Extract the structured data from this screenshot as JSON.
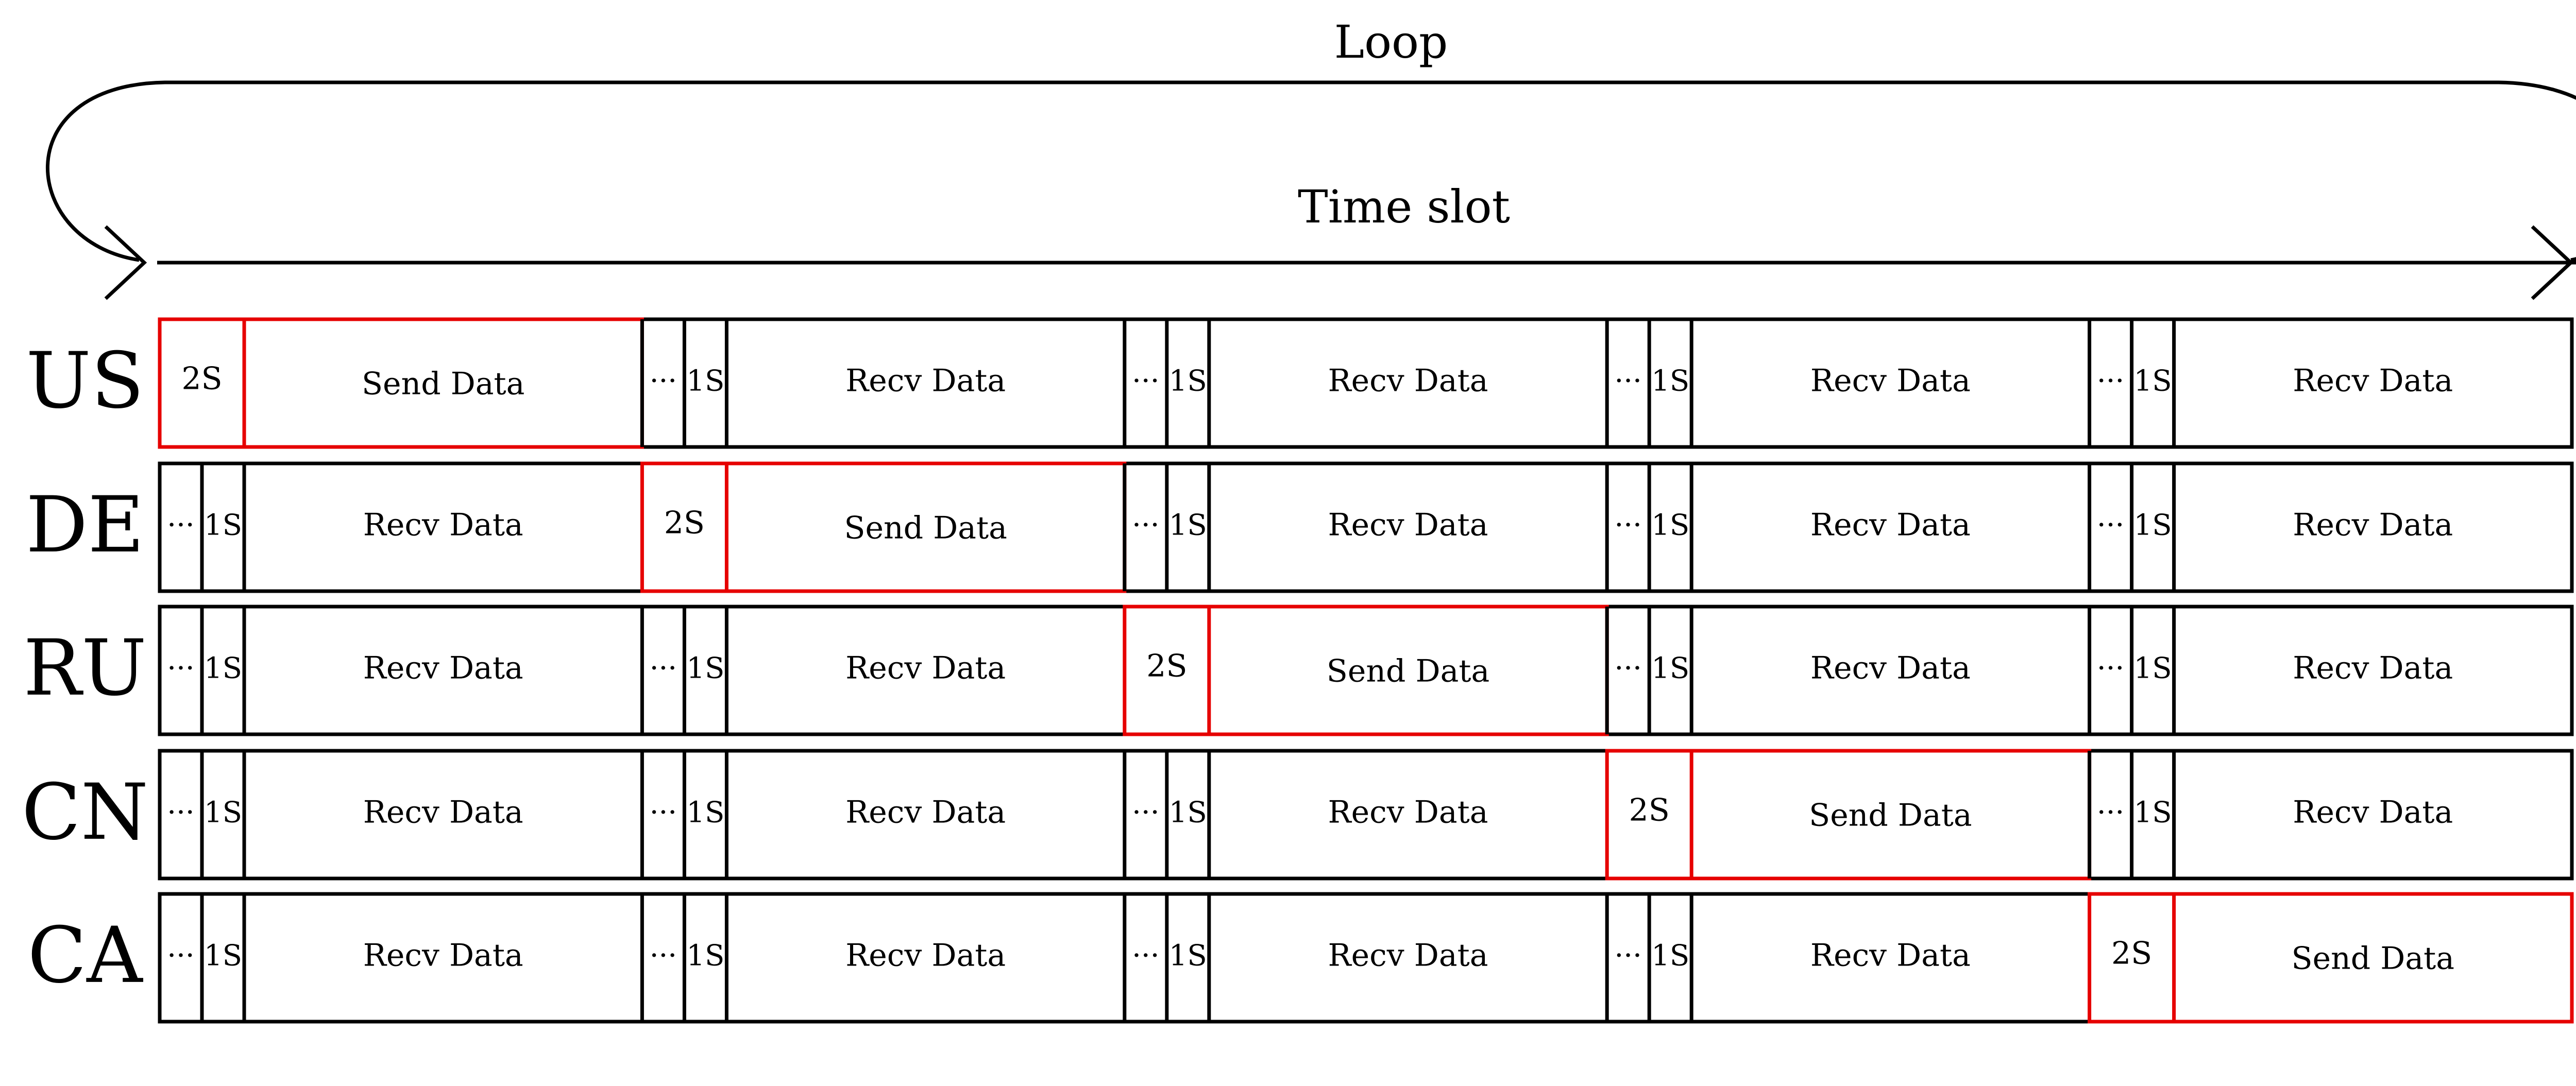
{
  "diagram": {
    "loop_label": "Loop",
    "timeslot_label": "Time slot",
    "dots": "···",
    "colors": {
      "line": "#000000",
      "highlight": "#e60000"
    },
    "rows": [
      {
        "label": "US",
        "slots": [
          {
            "type": "send",
            "marker": "2S",
            "text": "Send Data"
          },
          {
            "type": "recv",
            "marker": "1S",
            "text": "Recv Data"
          },
          {
            "type": "recv",
            "marker": "1S",
            "text": "Recv Data"
          },
          {
            "type": "recv",
            "marker": "1S",
            "text": "Recv Data"
          },
          {
            "type": "recv",
            "marker": "1S",
            "text": "Recv Data"
          }
        ]
      },
      {
        "label": "DE",
        "slots": [
          {
            "type": "recv",
            "marker": "1S",
            "text": "Recv Data"
          },
          {
            "type": "send",
            "marker": "2S",
            "text": "Send Data"
          },
          {
            "type": "recv",
            "marker": "1S",
            "text": "Recv Data"
          },
          {
            "type": "recv",
            "marker": "1S",
            "text": "Recv Data"
          },
          {
            "type": "recv",
            "marker": "1S",
            "text": "Recv Data"
          }
        ]
      },
      {
        "label": "RU",
        "slots": [
          {
            "type": "recv",
            "marker": "1S",
            "text": "Recv Data"
          },
          {
            "type": "recv",
            "marker": "1S",
            "text": "Recv Data"
          },
          {
            "type": "send",
            "marker": "2S",
            "text": "Send Data"
          },
          {
            "type": "recv",
            "marker": "1S",
            "text": "Recv Data"
          },
          {
            "type": "recv",
            "marker": "1S",
            "text": "Recv Data"
          }
        ]
      },
      {
        "label": "CN",
        "slots": [
          {
            "type": "recv",
            "marker": "1S",
            "text": "Recv Data"
          },
          {
            "type": "recv",
            "marker": "1S",
            "text": "Recv Data"
          },
          {
            "type": "recv",
            "marker": "1S",
            "text": "Recv Data"
          },
          {
            "type": "send",
            "marker": "2S",
            "text": "Send Data"
          },
          {
            "type": "recv",
            "marker": "1S",
            "text": "Recv Data"
          }
        ]
      },
      {
        "label": "CA",
        "slots": [
          {
            "type": "recv",
            "marker": "1S",
            "text": "Recv Data"
          },
          {
            "type": "recv",
            "marker": "1S",
            "text": "Recv Data"
          },
          {
            "type": "recv",
            "marker": "1S",
            "text": "Recv Data"
          },
          {
            "type": "recv",
            "marker": "1S",
            "text": "Recv Data"
          },
          {
            "type": "send",
            "marker": "2S",
            "text": "Send Data"
          }
        ]
      }
    ]
  }
}
